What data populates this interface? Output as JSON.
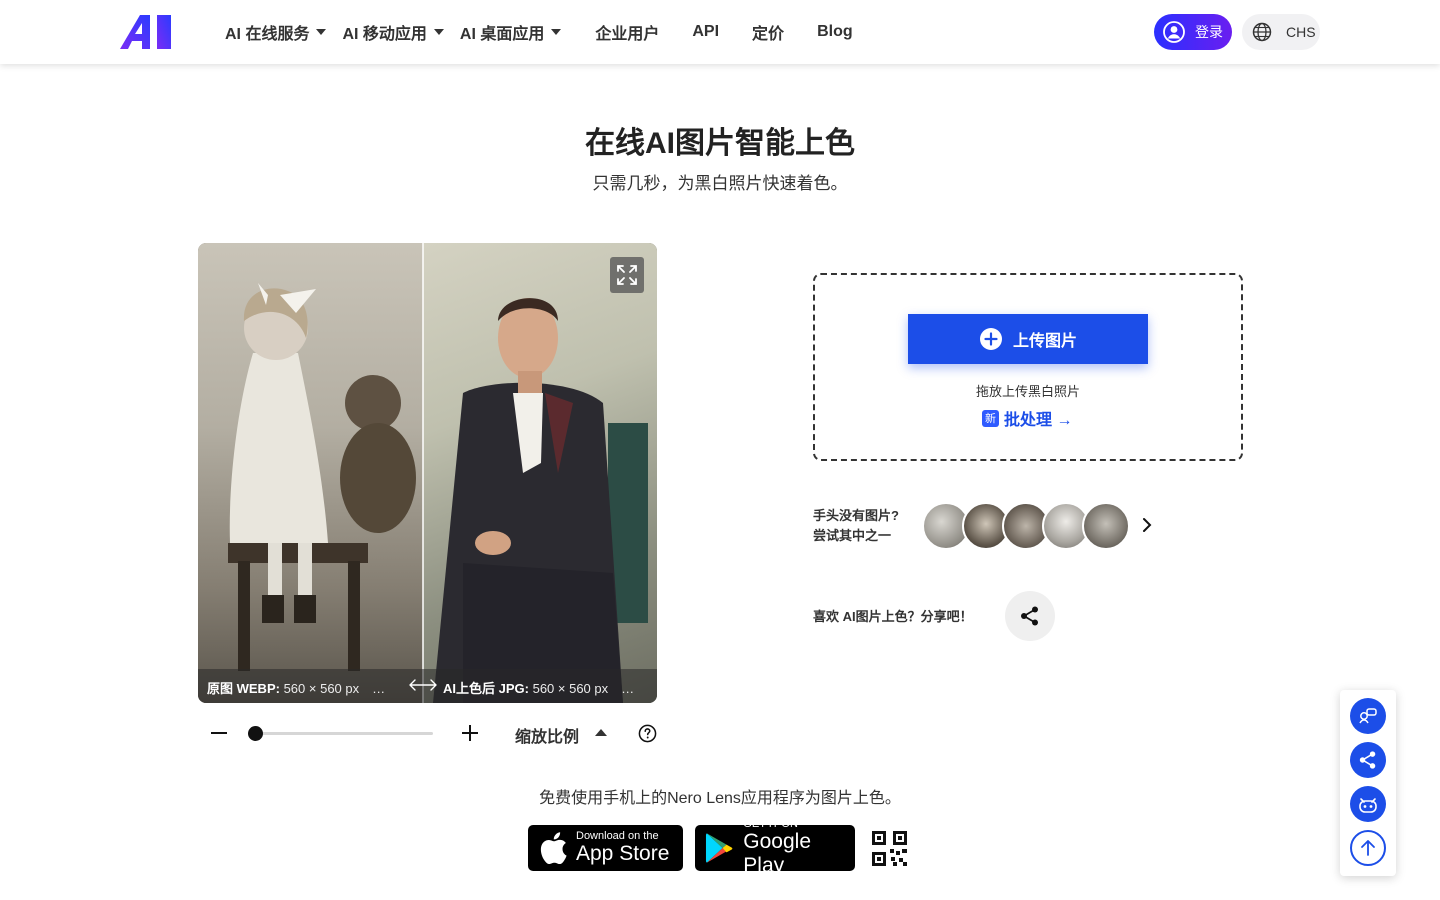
{
  "header": {
    "nav": [
      {
        "label": "AI 在线服务",
        "dropdown": true
      },
      {
        "label": "AI 移动应用",
        "dropdown": true
      },
      {
        "label": "AI 桌面应用",
        "dropdown": true
      },
      {
        "label": "企业用户",
        "dropdown": false
      },
      {
        "label": "API",
        "dropdown": false
      },
      {
        "label": "定价",
        "dropdown": false
      },
      {
        "label": "Blog",
        "dropdown": false
      }
    ],
    "login_label": "登录",
    "lang_label": "CHS"
  },
  "hero": {
    "title": "在线AI图片智能上色",
    "subtitle": "只需几秒，为黑白照片快速着色。"
  },
  "viewer": {
    "left_caption_title": "原图 WEBP:",
    "left_caption_value": "560 × 560 px　…",
    "right_caption_title": "AI上色后 JPG:",
    "right_caption_value": "560 × 560 px　…",
    "zoom_label": "缩放比例",
    "zoom_level": 0.03
  },
  "upload": {
    "button_label": "上传图片",
    "drop_hint": "拖放上传黑白照片",
    "new_badge": "新",
    "batch_label": "批处理 →"
  },
  "samples": {
    "prompt_line1": "手头没有图片?",
    "prompt_line2": "尝试其中之一",
    "count": 5
  },
  "share": {
    "label": "喜欢 AI图片上色？分享吧！"
  },
  "promo": {
    "text": "免费使用手机上的Nero Lens应用程序为图片上色。",
    "appstore_small": "Download on the",
    "appstore_big": "App Store",
    "gplay_small": "GET IT ON",
    "gplay_big": "Google Play"
  },
  "colors": {
    "accent": "#1c4ee8",
    "login_gradient_start": "#2b30ff",
    "login_gradient_end": "#6a1ef0"
  }
}
